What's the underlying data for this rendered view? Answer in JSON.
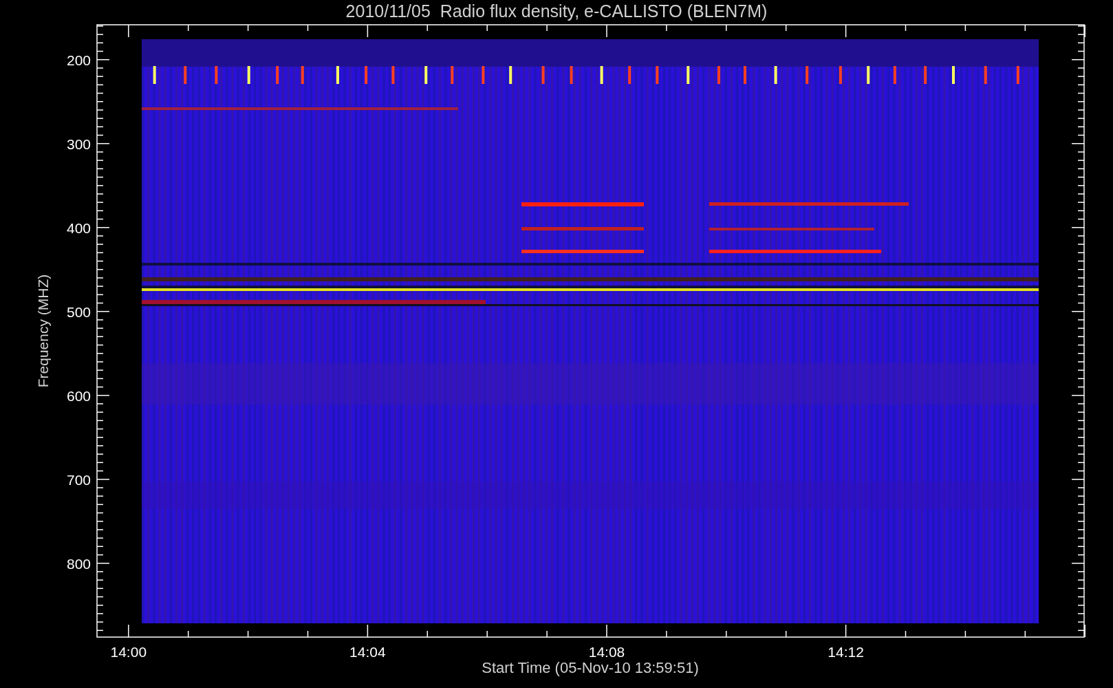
{
  "title": "2010/11/05  Radio flux density, e-CALLISTO (BLEN7M)",
  "y_axis": {
    "label": "Frequency (MHZ)",
    "ticks": [
      "200",
      "300",
      "400",
      "500",
      "600",
      "700",
      "800"
    ]
  },
  "x_axis": {
    "label": "Start Time (05-Nov-10 13:59:51)",
    "ticks": [
      "14:00",
      "14:04",
      "14:08",
      "14:12"
    ]
  }
}
